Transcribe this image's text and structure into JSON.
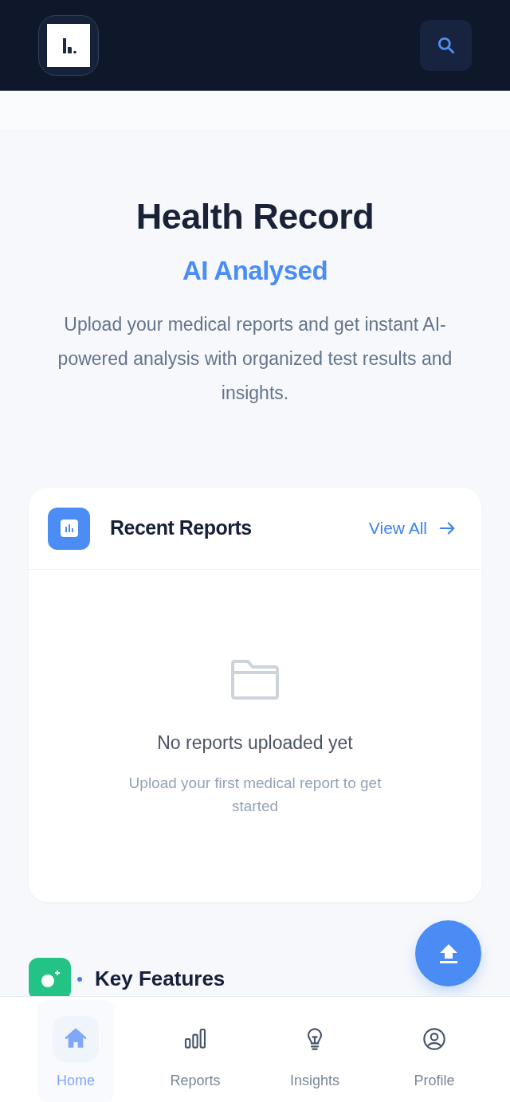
{
  "hero": {
    "title": "Health Record",
    "subtitle": "AI Analysed",
    "description": "Upload your medical reports and get instant AI-powered analysis with organized test results and insights."
  },
  "recent_reports": {
    "title": "Recent Reports",
    "link": "View All",
    "empty_title": "No reports uploaded yet",
    "empty_text": "Upload your first medical report to get started"
  },
  "key_features": {
    "title": "Key Features"
  },
  "nav": [
    {
      "label": "Home",
      "kind": "home",
      "selected": true
    },
    {
      "label": "Reports",
      "kind": "chart",
      "selected": false
    },
    {
      "label": "Insights",
      "kind": "bulb",
      "selected": false
    },
    {
      "label": "Profile",
      "kind": "user",
      "selected": false
    }
  ]
}
